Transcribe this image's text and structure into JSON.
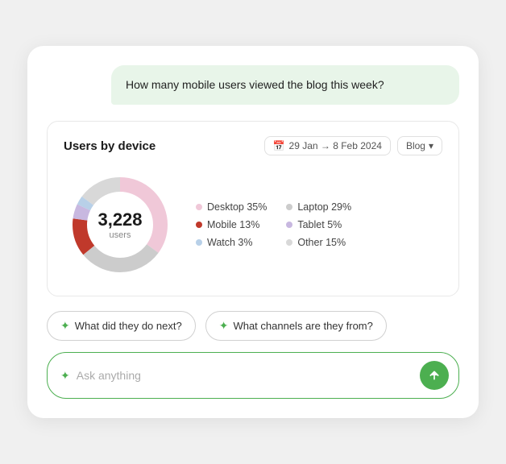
{
  "chat": {
    "bubble_text": "How many mobile users viewed the blog this week?"
  },
  "widget": {
    "title": "Users by device",
    "date_range": "29 Jan → 8 Feb 2024",
    "filter": "Blog",
    "total_users": "3,228",
    "total_label": "users",
    "legend": [
      {
        "label": "Desktop 35%",
        "color": "#e8d0d8"
      },
      {
        "label": "Laptop 29%",
        "color": "#cccccc"
      },
      {
        "label": "Mobile 13%",
        "color": "#c0392b"
      },
      {
        "label": "Tablet 5%",
        "color": "#d0c8e0"
      },
      {
        "label": "Watch 3%",
        "color": "#c8d8e8"
      },
      {
        "label": "Other 15%",
        "color": "#d0d0d0"
      }
    ]
  },
  "suggestions": [
    {
      "label": "What did they do next?"
    },
    {
      "label": "What channels are they from?"
    }
  ],
  "input": {
    "placeholder": "Ask anything"
  },
  "icons": {
    "calendar": "📅",
    "chevron_down": "▾",
    "sparkle": "✦",
    "send_arrow": "↑"
  }
}
